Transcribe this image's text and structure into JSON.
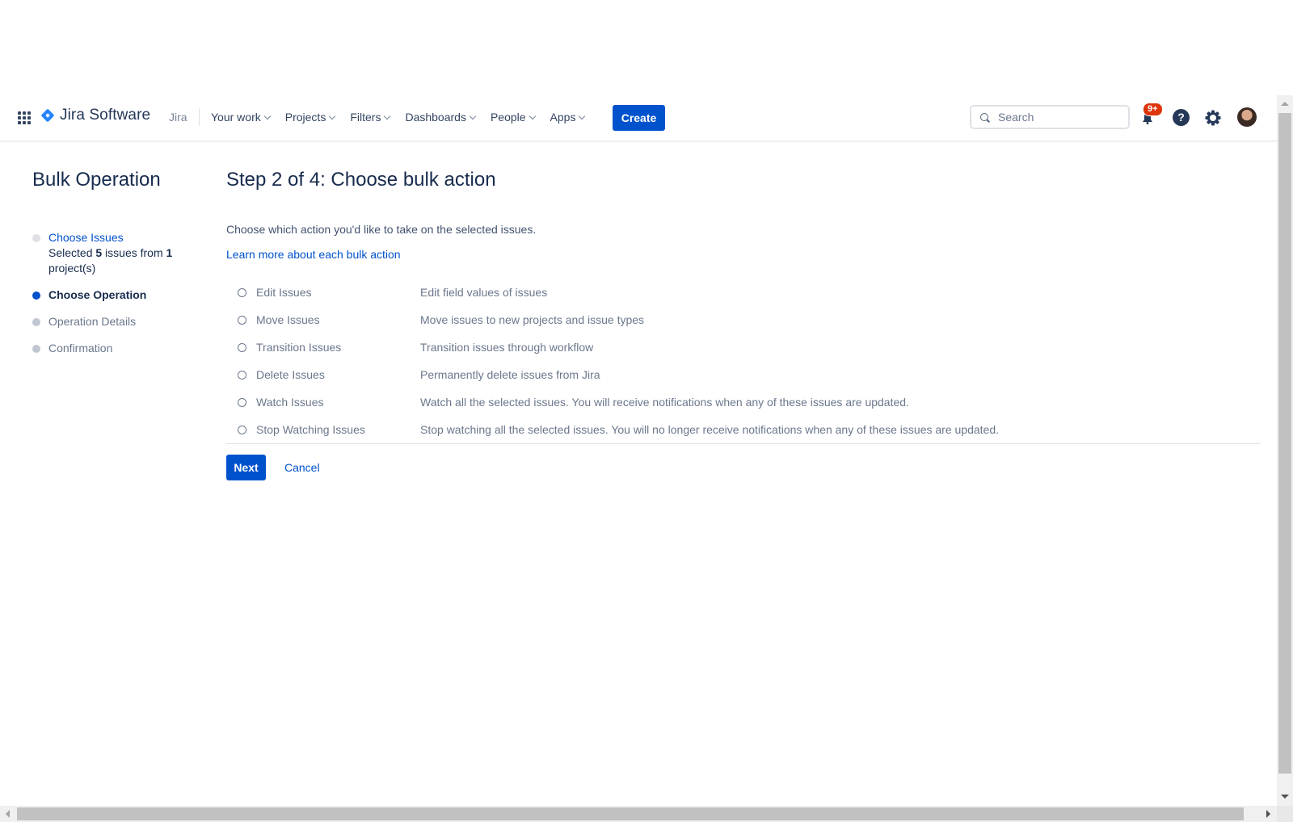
{
  "nav": {
    "logo_text": "Jira Software",
    "product_label": "Jira",
    "items": [
      {
        "label": "Your work"
      },
      {
        "label": "Projects"
      },
      {
        "label": "Filters"
      },
      {
        "label": "Dashboards"
      },
      {
        "label": "People"
      },
      {
        "label": "Apps"
      }
    ],
    "create_label": "Create",
    "search_placeholder": "Search",
    "notification_badge": "9+",
    "help_glyph": "?"
  },
  "sidebar": {
    "title": "Bulk Operation",
    "steps": [
      {
        "label": "Choose Issues",
        "state": "done",
        "sub_prefix": "Selected ",
        "sub_count": "5",
        "sub_mid": " issues from ",
        "sub_projects": "1",
        "sub_suffix": " project(s)"
      },
      {
        "label": "Choose Operation",
        "state": "current"
      },
      {
        "label": "Operation Details",
        "state": "future"
      },
      {
        "label": "Confirmation",
        "state": "future"
      }
    ]
  },
  "main": {
    "title": "Step 2 of 4: Choose bulk action",
    "intro": "Choose which action you'd like to take on the selected issues.",
    "learn_more": "Learn more about each bulk action",
    "options": [
      {
        "label": "Edit Issues",
        "description": "Edit field values of issues",
        "selected": false
      },
      {
        "label": "Move Issues",
        "description": "Move issues to new projects and issue types",
        "selected": false
      },
      {
        "label": "Transition Issues",
        "description": "Transition issues through workflow",
        "selected": false
      },
      {
        "label": "Delete Issues",
        "description": "Permanently delete issues from Jira",
        "selected": false
      },
      {
        "label": "Watch Issues",
        "description": "Watch all the selected issues. You will receive notifications when any of these issues are updated.",
        "selected": false
      },
      {
        "label": "Stop Watching Issues",
        "description": "Stop watching all the selected issues. You will no longer receive notifications when any of these issues are updated.",
        "selected": false
      }
    ],
    "next_label": "Next",
    "cancel_label": "Cancel"
  }
}
